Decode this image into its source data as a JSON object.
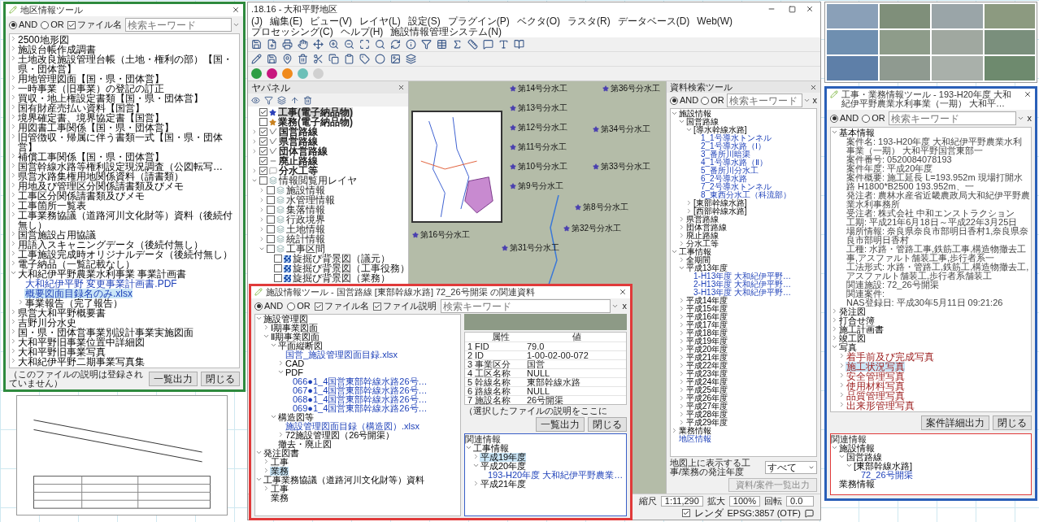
{
  "district_tool": {
    "title": "地区情報ツール",
    "modes": [
      {
        "label": "AND",
        "selected": true
      },
      {
        "label": "OR",
        "selected": false
      }
    ],
    "filters": [
      {
        "label": "ファイル名",
        "checked": true
      }
    ],
    "search": {
      "placeholder": "検索キーワード"
    },
    "tree": [
      {
        "label": "2500地形図",
        "kind": "group",
        "selected": false,
        "expanded": false
      },
      {
        "label": "施設台帳作成調書",
        "kind": "group",
        "selected": false,
        "expanded": false
      },
      {
        "label": "土地改良施設管理台帳（土地・権利の部）【国・県・団体営】",
        "kind": "group",
        "selected": false,
        "expanded": false
      },
      {
        "label": "用地管理図面【国・県・団体営】",
        "kind": "group",
        "selected": false,
        "expanded": false
      },
      {
        "label": "一時事業（旧事業）の登記の訂正",
        "kind": "group",
        "selected": false,
        "expanded": false
      },
      {
        "label": "買収・地上権設定書類【国・県・団体営】",
        "kind": "group",
        "selected": false,
        "expanded": false
      },
      {
        "label": "国有財産売払い資料【国営】",
        "kind": "group",
        "selected": false,
        "expanded": false
      },
      {
        "label": "境界確定書、境界協定書【国営】",
        "kind": "group",
        "selected": false,
        "expanded": false
      },
      {
        "label": "用図書工事関係【国・県・団体営】",
        "kind": "group",
        "selected": false,
        "expanded": false
      },
      {
        "label": "旧管徴収・帰属に伴う書類一式【国・県・団体営】",
        "kind": "group",
        "selected": false,
        "expanded": false
      },
      {
        "label": "補償工事関係【国・県・団体営】",
        "kind": "group",
        "selected": false,
        "expanded": false
      },
      {
        "label": "国営幹線水路等権利設定現況調査（公図転写…",
        "kind": "group",
        "selected": false,
        "expanded": false
      },
      {
        "label": "県営水路集権用地関係資料（請書類）",
        "kind": "group",
        "selected": false,
        "expanded": false
      },
      {
        "label": "用地及び管理区分関係請書類及びメモ",
        "kind": "group",
        "selected": false,
        "expanded": false
      },
      {
        "label": "工事区分関係請書類及びメモ",
        "kind": "group",
        "selected": false,
        "expanded": false
      },
      {
        "label": "工事箇所一覧表",
        "kind": "group",
        "selected": false,
        "expanded": false
      },
      {
        "label": "工事業務協議（道路河川文化財等）資料（後続付無し）",
        "kind": "group",
        "selected": false,
        "expanded": false
      },
      {
        "label": "国営施設占用協議",
        "kind": "group",
        "selected": false,
        "expanded": false
      },
      {
        "label": "用語入スキャニングデータ（後続付無し）",
        "kind": "group",
        "selected": false,
        "expanded": false
      },
      {
        "label": "工事施設完成時オリジナルデータ（後続付無し）",
        "kind": "group",
        "selected": false,
        "expanded": false
      },
      {
        "label": "電子納品（一覧記載なし）",
        "kind": "group",
        "selected": false,
        "expanded": false
      },
      {
        "label": "大和紀伊平野農業水利事業 事業計画書",
        "kind": "group",
        "selected": false,
        "expanded": true,
        "children": [
          {
            "label": "大和紀伊平野 変更事業計画書.PDF",
            "kind": "file",
            "selected": false
          },
          {
            "label": "概要図面目録名のみ.xlsx",
            "kind": "file",
            "selected": true
          },
          {
            "label": "事業報告（完了報告）",
            "kind": "group",
            "selected": false,
            "expanded": false
          }
        ]
      },
      {
        "label": "県営大和平野概要書",
        "kind": "group",
        "selected": false,
        "expanded": false
      },
      {
        "label": "吉野川分水史",
        "kind": "group",
        "selected": false,
        "expanded": false
      },
      {
        "label": "国・県・団体営事業別設計事業実施図面",
        "kind": "group",
        "selected": false,
        "expanded": false
      },
      {
        "label": "大和平野旧事業位置中詳細図",
        "kind": "group",
        "selected": false,
        "expanded": false
      },
      {
        "label": "大和平野旧事業写真",
        "kind": "group",
        "selected": false,
        "expanded": false
      },
      {
        "label": "大和紀伊平野二期事業写真集",
        "kind": "group",
        "selected": false,
        "expanded": false
      }
    ],
    "description": "（このファイルの説明は登録されていません）",
    "buttons": [
      "一覧出力",
      "閉じる"
    ]
  },
  "qgis": {
    "title": ".18.16 - 大和平野地区",
    "menu": [
      "(J)",
      "編集(E)",
      "ビュー(V)",
      "レイヤ(L)",
      "設定(S)",
      "プラグイン(P)",
      "ベクタ(O)",
      "ラスタ(R)",
      "データベース(D)",
      "Web(W)",
      "プロセッシング(C)",
      "ヘルプ(H)",
      "施設情報管理システム(N)"
    ],
    "layer_panel": {
      "title": "ヤパネル",
      "layers": [
        {
          "label": "工事(電子納品物)",
          "kind": "point",
          "color": "#2a3fb8",
          "checked": true,
          "selected": true
        },
        {
          "label": "業務(電子納品物)",
          "kind": "point",
          "color": "#c8801e",
          "checked": false,
          "selected": false
        },
        {
          "label": "国営路線",
          "kind": "line",
          "checked": true,
          "selected": false,
          "expanded": false
        },
        {
          "label": "県営路線",
          "kind": "line",
          "checked": true,
          "selected": false,
          "expanded": false
        },
        {
          "label": "団体営路線",
          "kind": "line",
          "checked": true,
          "selected": false,
          "expanded": false
        },
        {
          "label": "廃止路線",
          "kind": "dash",
          "checked": true,
          "selected": false
        },
        {
          "label": "分水工等",
          "kind": "label",
          "checked": true,
          "selected": false,
          "expanded": false
        },
        {
          "label": "情報閲覧用レイヤ",
          "kind": "group",
          "checked": false,
          "selected": false,
          "expanded": true,
          "children": [
            {
              "label": "施設情報",
              "kind": "group",
              "checked": false,
              "selected": false,
              "expanded": false
            },
            {
              "label": "水管理情報",
              "kind": "group",
              "checked": false,
              "selected": false,
              "expanded": false
            },
            {
              "label": "集落情報",
              "kind": "group",
              "checked": false,
              "selected": false,
              "expanded": false
            },
            {
              "label": "行政境界",
              "kind": "group",
              "checked": false,
              "selected": false,
              "expanded": false
            },
            {
              "label": "土地情報",
              "kind": "group",
              "checked": false,
              "selected": false,
              "expanded": false
            },
            {
              "label": "統計情報",
              "kind": "group",
              "checked": false,
              "selected": false,
              "expanded": false
            },
            {
              "label": "工事区間",
              "kind": "group",
              "checked": false,
              "selected": false,
              "expanded": true,
              "children": [
                {
                  "label": "旋掘び背景図（議元）",
                  "kind": "raster",
                  "checked": false,
                  "selected": false
                },
                {
                  "label": "旋掘び背景図（工事役務）",
                  "kind": "raster",
                  "checked": false,
                  "selected": false
                },
                {
                  "label": "旋掘び背景図（業務）",
                  "kind": "raster",
                  "checked": false,
                  "selected": false
                }
              ]
            }
          ]
        }
      ]
    },
    "map": {
      "labels": [
        "第14号分水工",
        "第13号分水工",
        "第12号分水工",
        "第16号分水工",
        "第11号分水工",
        "第10号分水工",
        "第9号分水工",
        "第8号分水工",
        "第36号分水工",
        "第34号分水工",
        "第33号分水工",
        "第32号分水工",
        "第31号分水工"
      ]
    },
    "search_panel": {
      "title": "資料検索ツール",
      "modes": [
        {
          "label": "AND",
          "selected": true
        },
        {
          "label": "OR",
          "selected": false
        }
      ],
      "search": {
        "placeholder": "検索キーワード"
      },
      "clear": "x",
      "tree": [
        {
          "label": "施設情報",
          "kind": "group",
          "selected": false,
          "expanded": true,
          "children": [
            {
              "label": "国営路線",
              "kind": "group",
              "selected": false,
              "expanded": true,
              "children": [
                {
                  "label": "[導水幹線水路]",
                  "kind": "group",
                  "selected": false,
                  "expanded": true,
                  "children": [
                    {
                      "label": "1_1号導水トンネル",
                      "kind": "file",
                      "selected": false
                    },
                    {
                      "label": "2_1号導水路（Ⅰ）",
                      "kind": "file",
                      "selected": false
                    },
                    {
                      "label": "3_番所川暗渠",
                      "kind": "file",
                      "selected": false
                    },
                    {
                      "label": "4_1号導水路（Ⅱ）",
                      "kind": "file",
                      "selected": false
                    },
                    {
                      "label": "5_番所川分水工",
                      "kind": "file",
                      "selected": false
                    },
                    {
                      "label": "6_2号導水路",
                      "kind": "file",
                      "selected": false
                    },
                    {
                      "label": "7_2号導水トンネル",
                      "kind": "file",
                      "selected": false
                    },
                    {
                      "label": "8_東西分水工（科流部）",
                      "kind": "file",
                      "selected": false
                    }
                  ]
                },
                {
                  "label": "[東部幹線水路]",
                  "kind": "group",
                  "selected": false,
                  "expanded": false
                },
                {
                  "label": "[西部幹線水路]",
                  "kind": "group",
                  "selected": false,
                  "expanded": false
                }
              ]
            },
            {
              "label": "県営路線",
              "kind": "group",
              "selected": false,
              "expanded": false
            },
            {
              "label": "団体営路線",
              "kind": "group",
              "selected": false,
              "expanded": false
            },
            {
              "label": "廃止路線",
              "kind": "group",
              "selected": false,
              "expanded": false
            },
            {
              "label": "分水工等",
              "kind": "group",
              "selected": false,
              "expanded": false
            }
          ]
        },
        {
          "label": "工事情報",
          "kind": "group",
          "selected": false,
          "expanded": true,
          "children": [
            {
              "label": "全期間",
              "kind": "group",
              "selected": false,
              "expanded": false
            },
            {
              "label": "平成13年度",
              "kind": "group",
              "selected": false,
              "expanded": true,
              "children": [
                {
                  "label": "1-H13年度 大和紀伊平野…",
                  "kind": "file",
                  "selected": false
                },
                {
                  "label": "2-H13年度 大和紀伊平野…",
                  "kind": "file",
                  "selected": false
                },
                {
                  "label": "3-H13年度 大和紀伊平野…",
                  "kind": "file",
                  "selected": false
                }
              ]
            },
            {
              "label": "平成14年度",
              "kind": "group",
              "selected": false,
              "expanded": false
            },
            {
              "label": "平成15年度",
              "kind": "group",
              "selected": false,
              "expanded": false
            },
            {
              "label": "平成16年度",
              "kind": "group",
              "selected": false,
              "expanded": false
            },
            {
              "label": "平成17年度",
              "kind": "group",
              "selected": false,
              "expanded": false
            },
            {
              "label": "平成18年度",
              "kind": "group",
              "selected": false,
              "expanded": false
            },
            {
              "label": "平成19年度",
              "kind": "group",
              "selected": false,
              "expanded": false
            },
            {
              "label": "平成20年度",
              "kind": "group",
              "selected": false,
              "expanded": false
            },
            {
              "label": "平成21年度",
              "kind": "group",
              "selected": false,
              "expanded": false
            },
            {
              "label": "平成22年度",
              "kind": "group",
              "selected": false,
              "expanded": false
            },
            {
              "label": "平成23年度",
              "kind": "group",
              "selected": false,
              "expanded": false
            },
            {
              "label": "平成24年度",
              "kind": "group",
              "selected": false,
              "expanded": false
            },
            {
              "label": "平成25年度",
              "kind": "group",
              "selected": false,
              "expanded": false
            },
            {
              "label": "平成26年度",
              "kind": "group",
              "selected": false,
              "expanded": false
            },
            {
              "label": "平成27年度",
              "kind": "group",
              "selected": false,
              "expanded": false
            },
            {
              "label": "平成28年度",
              "kind": "group",
              "selected": false,
              "expanded": false
            },
            {
              "label": "平成29年度",
              "kind": "group",
              "selected": false,
              "expanded": false
            }
          ]
        },
        {
          "label": "業務情報",
          "kind": "group",
          "selected": false,
          "expanded": false
        },
        {
          "label": "地区情報",
          "kind": "file",
          "selected": false
        }
      ],
      "year_filter": {
        "label": "地図上に表示する工事/業務の発注年度",
        "value": "すべて"
      },
      "export_button": {
        "label": "資料/案件一覧出力",
        "disabled": true
      }
    },
    "status_bar": {
      "scale_label": "縮尺",
      "scale": "1:11,290",
      "zoom_label": "拡大",
      "zoom": "100%",
      "rotation_label": "回転",
      "rotation": "0.0",
      "render": {
        "label": "レンダ",
        "checked": true
      },
      "crs": "EPSG:3857 (OTF)"
    }
  },
  "facility_tool": {
    "title": "施設情報ツール - 国営路線 [東部幹線水路] 72_26号開渠 の関連資料",
    "modes": [
      {
        "label": "AND",
        "selected": true
      },
      {
        "label": "OR",
        "selected": false
      }
    ],
    "filters": [
      {
        "label": "ファイル名",
        "checked": true
      },
      {
        "label": "ファイル説明",
        "checked": true
      }
    ],
    "search": {
      "placeholder": "検索キーワード"
    },
    "clear": "x",
    "tree": [
      {
        "label": "施設管理図",
        "kind": "group",
        "selected": false,
        "expanded": true,
        "children": [
          {
            "label": "Ⅰ期事業図面",
            "kind": "group",
            "selected": false,
            "expanded": false
          },
          {
            "label": "Ⅱ期事業図面",
            "kind": "group",
            "selected": false,
            "expanded": true,
            "children": [
              {
                "label": "平面縦断図",
                "kind": "group",
                "selected": false,
                "expanded": true,
                "children": [
                  {
                    "label": "国営_施設管理図面目録.xlsx",
                    "kind": "file",
                    "selected": false
                  },
                  {
                    "label": "CAD",
                    "kind": "group",
                    "selected": false,
                    "expanded": false
                  },
                  {
                    "label": "PDF",
                    "kind": "group",
                    "selected": false,
                    "expanded": true,
                    "children": [
                      {
                        "label": "066●1_4国営東部幹線水路26号…",
                        "kind": "file",
                        "selected": false
                      },
                      {
                        "label": "067●1_4国営東部幹線水路26号…",
                        "kind": "file",
                        "selected": false
                      },
                      {
                        "label": "068●1_4国営東部幹線水路26号…",
                        "kind": "file",
                        "selected": false
                      },
                      {
                        "label": "069●1_4国営東部幹線水路26号…",
                        "kind": "file",
                        "selected": false
                      }
                    ]
                  }
                ]
              },
              {
                "label": "構造図等",
                "kind": "group",
                "selected": false,
                "expanded": true,
                "children": [
                  {
                    "label": "施設管理図面目録（構造図）.xlsx",
                    "kind": "file",
                    "selected": false
                  },
                  {
                    "label": "72施設管理図（26号開渠）",
                    "kind": "group",
                    "selected": false,
                    "expanded": false
                  }
                ]
              },
              {
                "label": "撤去・廃止図",
                "kind": "group",
                "selected": false
              }
            ]
          }
        ]
      },
      {
        "label": "発注図書",
        "kind": "group",
        "selected": false,
        "expanded": true,
        "children": [
          {
            "label": "工事",
            "kind": "group",
            "selected": false,
            "expanded": false
          },
          {
            "label": "業務",
            "kind": "group",
            "selected": true,
            "expanded": false
          }
        ]
      },
      {
        "label": "工事業務協議（道路河川文化財等）資料",
        "kind": "group",
        "selected": false,
        "expanded": true,
        "children": [
          {
            "label": "工事",
            "kind": "group",
            "selected": false,
            "expanded": false
          },
          {
            "label": "業務",
            "kind": "group",
            "selected": false
          }
        ]
      }
    ],
    "description": "（選択したファイルの説明をここに",
    "buttons": [
      "一覧出力",
      "閉じる"
    ],
    "attributes": {
      "columns": [
        "属性",
        "値"
      ],
      "rows": [
        {
          "index": "1",
          "name": "FID",
          "value": "79.0"
        },
        {
          "index": "2",
          "name": "ID",
          "value": "1-00-02-00-072"
        },
        {
          "index": "3",
          "name": "事業区分",
          "value": "国営"
        },
        {
          "index": "4",
          "name": "工区名称",
          "value": "NULL"
        },
        {
          "index": "5",
          "name": "幹線名称",
          "value": "東部幹線水路"
        },
        {
          "index": "6",
          "name": "路線名称",
          "value": "NULL"
        },
        {
          "index": "7",
          "name": "施設名称",
          "value": "26号開渠"
        }
      ]
    },
    "related": {
      "title": "関連情報",
      "tree": [
        {
          "label": "工事情報",
          "kind": "group",
          "selected": false,
          "expanded": true,
          "children": [
            {
              "label": "平成19年度",
              "kind": "group",
              "selected": true,
              "expanded": false
            },
            {
              "label": "平成20年度",
              "kind": "group",
              "selected": false,
              "expanded": true,
              "children": [
                {
                  "label": "193-H20年度 大和紀伊平野農業…",
                  "kind": "file",
                  "selected": false
                }
              ]
            },
            {
              "label": "平成21年度",
              "kind": "group",
              "selected": false,
              "expanded": false
            }
          ]
        }
      ]
    }
  },
  "work_tool": {
    "title": "工事・業務情報ツール - 193-H20年度 大和紀伊平野農業水利事業（一期） 大和平…",
    "modes": [
      {
        "label": "AND",
        "selected": true
      },
      {
        "label": "OR",
        "selected": false
      }
    ],
    "search": {
      "placeholder": "検索キーワード"
    },
    "clear": "x",
    "tree": [
      {
        "label": "基本情報",
        "kind": "group",
        "selected": false,
        "expanded": true,
        "children": [
          {
            "label": "案件名: 193-H20年度 大和紀伊平野農業水利事業（一期） 大和平野国営東部一",
            "kind": "field",
            "selected": false
          },
          {
            "label": "案件番号: 0520084078193",
            "kind": "field",
            "selected": false
          },
          {
            "label": "案件年度: 平成20年度",
            "kind": "field",
            "selected": false
          },
          {
            "label": "案件概要: 施工延長 L=193.952m 現場打開水路 H1800*B2500 193.952m、一",
            "kind": "field",
            "selected": false
          },
          {
            "label": "発注者: 農林水産省近畿農政局大和紀伊平野農業水利事務所",
            "kind": "field",
            "selected": false
          },
          {
            "label": "受注者: 株式会社 中和エンストラクション",
            "kind": "field",
            "selected": false
          },
          {
            "label": "工期: 平成21年6月18日～平成22年3月25日",
            "kind": "field",
            "selected": false
          },
          {
            "label": "場所情報: 奈良県奈良市部明日香村1,奈良県奈良市部明日香村",
            "kind": "field",
            "selected": false
          },
          {
            "label": "工種: 水路・管路工事,鉄筋工事,構造物撤去工事,アスファルト舗装工事,歩行者系一",
            "kind": "field",
            "selected": false
          },
          {
            "label": "工法形式: 水路・管路工,鉄筋工,構造物撤去工,アスファルト舗装工,歩行者系舗装工",
            "kind": "field",
            "selected": false
          },
          {
            "label": "関連施設: 72_26号開渠",
            "kind": "field",
            "selected": false
          },
          {
            "label": "関連案件:",
            "kind": "field",
            "selected": false
          },
          {
            "label": "NAS登録日: 平成30年5月11日 09:21:26",
            "kind": "field",
            "selected": false
          }
        ]
      },
      {
        "label": "発注図",
        "kind": "group",
        "selected": false,
        "expanded": false
      },
      {
        "label": "打合せ簿",
        "kind": "group",
        "selected": false,
        "expanded": false
      },
      {
        "label": "施工計画書",
        "kind": "group",
        "selected": false,
        "expanded": false
      },
      {
        "label": "竣工図",
        "kind": "group",
        "selected": false,
        "expanded": false
      },
      {
        "label": "写真",
        "kind": "group",
        "selected": false,
        "expanded": true,
        "children": [
          {
            "label": "着手前及び完成写真",
            "kind": "photo",
            "selected": false,
            "expanded": false
          },
          {
            "label": "施工状況写真",
            "kind": "photo",
            "selected": true,
            "expanded": false
          },
          {
            "label": "安全管理写真",
            "kind": "photo",
            "selected": false,
            "expanded": false
          },
          {
            "label": "使用材料写真",
            "kind": "photo",
            "selected": false,
            "expanded": false
          },
          {
            "label": "品質管理写真",
            "kind": "photo",
            "selected": false,
            "expanded": false
          },
          {
            "label": "出来形管理写真",
            "kind": "photo",
            "selected": false,
            "expanded": false
          }
        ]
      }
    ],
    "buttons": [
      "案件詳細出力",
      "閉じる"
    ],
    "related": {
      "title": "関連情報",
      "tree": [
        {
          "label": "施設情報",
          "kind": "group",
          "selected": false,
          "expanded": true,
          "children": [
            {
              "label": "国営路線",
              "kind": "group",
              "selected": false,
              "expanded": true,
              "children": [
                {
                  "label": "[東部幹線水路]",
                  "kind": "group",
                  "selected": false,
                  "expanded": true,
                  "children": [
                    {
                      "label": "72_26号開渠",
                      "kind": "file",
                      "selected": false
                    }
                  ]
                }
              ]
            }
          ]
        },
        {
          "label": "業務情報",
          "kind": "group",
          "selected": false
        }
      ]
    }
  }
}
